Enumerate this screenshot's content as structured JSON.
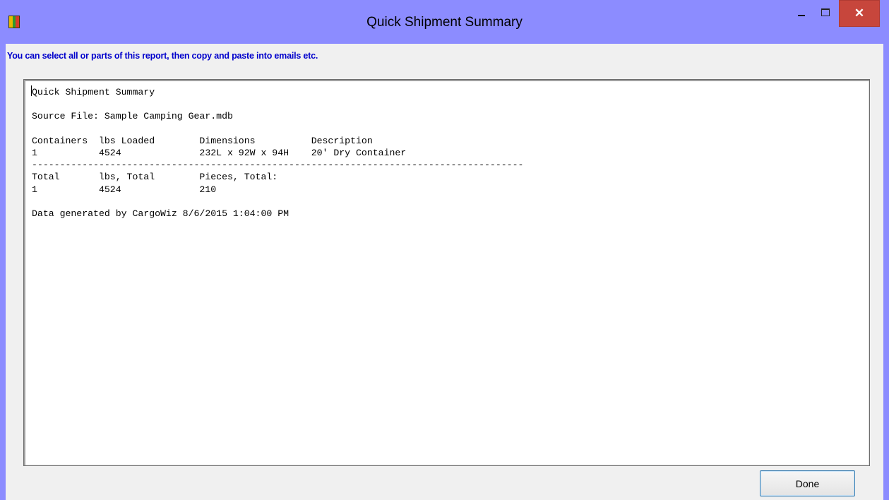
{
  "window": {
    "title": "Quick Shipment Summary",
    "close_glyph": "✕",
    "icon": "app-grid-icon",
    "colors": {
      "frame": "#8c8cff",
      "close": "#c7463c",
      "hint_text": "#0000cc"
    }
  },
  "hint": "You can select all or parts of this report, then copy and paste into emails etc.",
  "report": {
    "lines": [
      "Quick Shipment Summary",
      "",
      "Source File: Sample Camping Gear.mdb",
      "",
      "Containers  lbs Loaded        Dimensions          Description",
      "1           4524              232L x 92W x 94H    20' Dry Container",
      "----------------------------------------------------------------------------------------",
      "Total       lbs, Total        Pieces, Total:",
      "1           4524              210",
      "",
      "Data generated by CargoWiz 8/6/2015 1:04:00 PM"
    ]
  },
  "buttons": {
    "done": "Done"
  }
}
